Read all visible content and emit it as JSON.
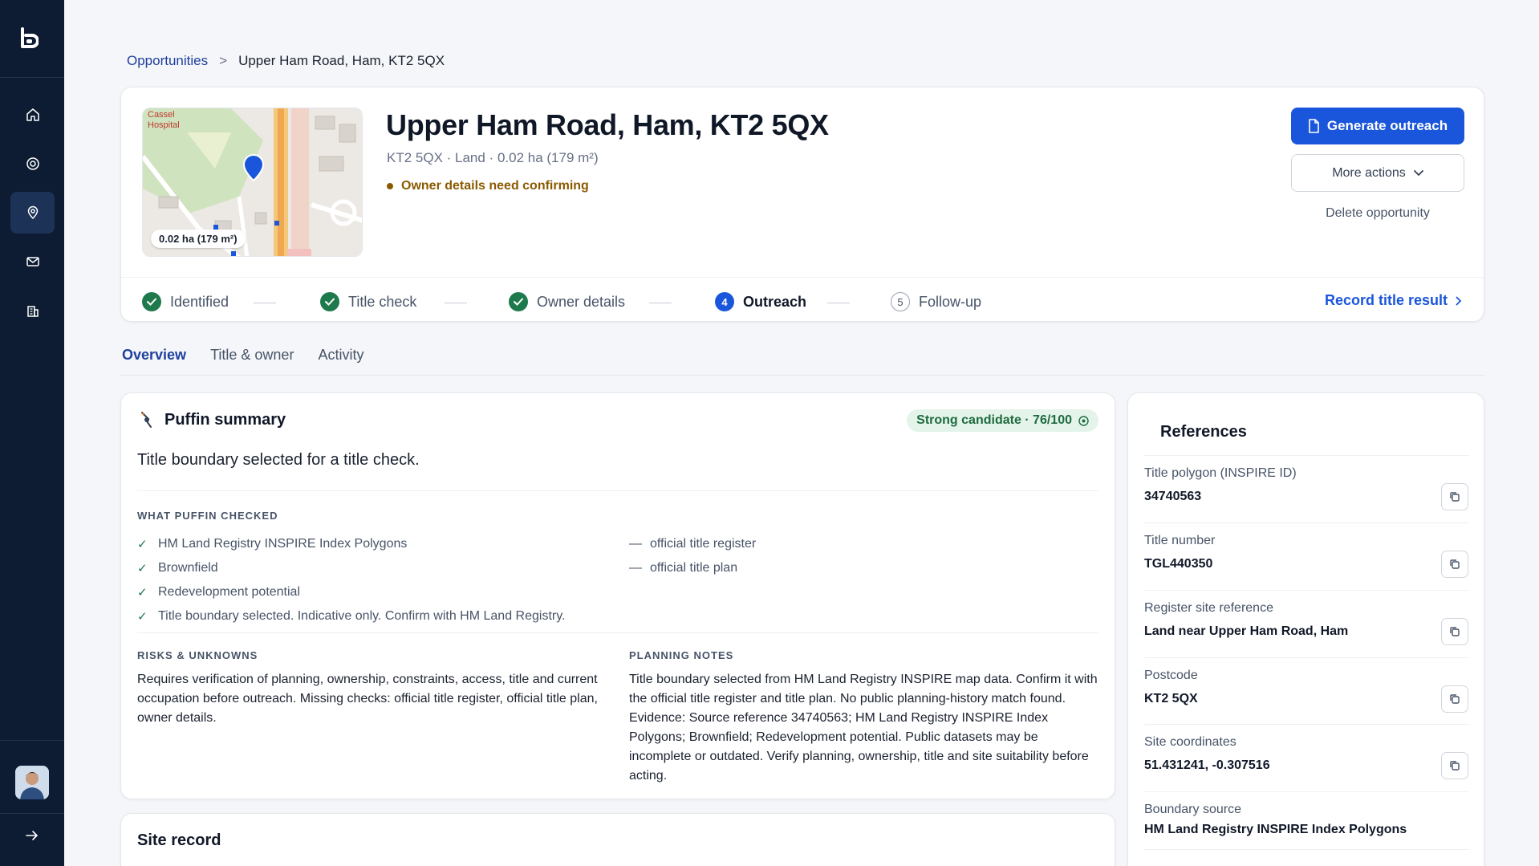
{
  "breadcrumb": {
    "parent": "Opportunities",
    "separator": ">",
    "current": "Upper Ham Road, Ham, KT2 5QX"
  },
  "header": {
    "title": "Upper Ham Road, Ham, KT2 5QX",
    "meta": "KT2 5QX · Land · 0.02 ha (179 m²)",
    "status": "Owner details need confirming",
    "map_badge": "0.02 ha (179 m²)",
    "map_label": "Cassel Hospital",
    "primary_button": "Generate outreach",
    "more_actions": "More actions",
    "delete": "Delete opportunity",
    "record_link": "Record title result"
  },
  "steps": [
    {
      "label": "Identified",
      "state": "done"
    },
    {
      "label": "Title check",
      "state": "done"
    },
    {
      "label": "Owner details",
      "state": "done"
    },
    {
      "label": "Outreach",
      "state": "current",
      "number": "4"
    },
    {
      "label": "Follow-up",
      "state": "todo",
      "number": "5"
    }
  ],
  "tabs": [
    "Overview",
    "Title & owner",
    "Activity"
  ],
  "puffin": {
    "title": "Puffin summary",
    "score": "Strong candidate · 76/100",
    "summary": "Title boundary selected for a title check.",
    "checked_label": "WHAT PUFFIN CHECKED",
    "checked": [
      "HM Land Registry INSPIRE Index Polygons",
      "Brownfield",
      "Redevelopment potential",
      "Title boundary selected. Indicative only. Confirm with HM Land Registry."
    ],
    "missing": [
      "official title register",
      "official title plan"
    ],
    "risks_label": "RISKS & UNKNOWNS",
    "risks_text": "Requires verification of planning, ownership, constraints, access, title and current occupation before outreach. Missing checks: official title register, official title plan, owner details.",
    "planning_label": "PLANNING NOTES",
    "planning_text": "Title boundary selected from HM Land Registry INSPIRE map data. Confirm it with the official title register and title plan. No public planning-history match found. Evidence: Source reference 34740563; HM Land Registry INSPIRE Index Polygons; Brownfield; Redevelopment potential. Public datasets may be incomplete or outdated. Verify planning, ownership, title and site suitability before acting."
  },
  "site_record": {
    "title": "Site record"
  },
  "references": {
    "title": "References",
    "items": [
      {
        "label": "Title polygon (INSPIRE ID)",
        "value": "34740563"
      },
      {
        "label": "Title number",
        "value": "TGL440350"
      },
      {
        "label": "Register site reference",
        "value": "Land near Upper Ham Road, Ham"
      },
      {
        "label": "Postcode",
        "value": "KT2 5QX"
      },
      {
        "label": "Site coordinates",
        "value": "51.431241, -0.307516"
      },
      {
        "label": "Boundary source",
        "value": "HM Land Registry INSPIRE Index Polygons"
      }
    ]
  },
  "colors": {
    "sidebar": "#0d1b33",
    "primary": "#1a56db",
    "success": "#1e7a4c",
    "warning": "#8a5a00"
  },
  "icons": {
    "sidebar": [
      "home-icon",
      "target-icon",
      "map-pin-icon",
      "mail-icon",
      "building-icon"
    ],
    "copy": "copy-icon"
  }
}
